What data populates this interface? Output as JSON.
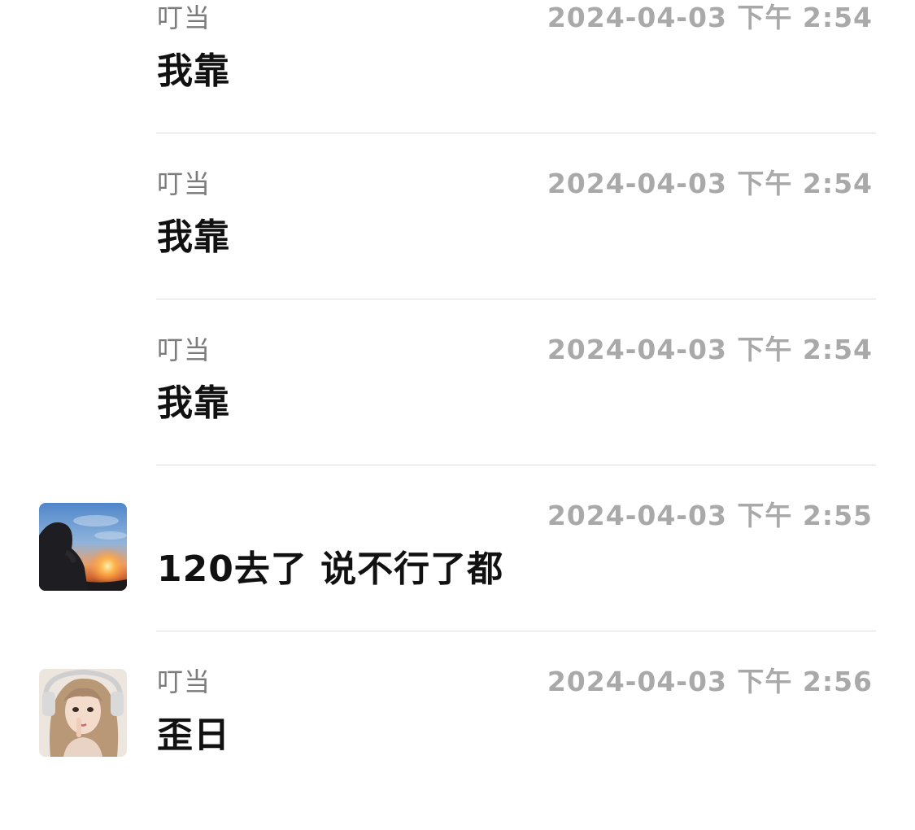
{
  "messages": [
    {
      "sender": "叮当",
      "time": "2024-04-03 下午 2:54",
      "text": "我靠",
      "avatar": ""
    },
    {
      "sender": "叮当",
      "time": "2024-04-03 下午 2:54",
      "text": "我靠",
      "avatar": ""
    },
    {
      "sender": "叮当",
      "time": "2024-04-03 下午 2:54",
      "text": "我靠",
      "avatar": ""
    },
    {
      "sender": "",
      "time": "2024-04-03 下午 2:55",
      "text": "120去了  说不行了都",
      "avatar": "sunset-silhouette-avatar"
    },
    {
      "sender": "叮当",
      "time": "2024-04-03 下午 2:56",
      "text": "歪日",
      "avatar": "girl-headphones-avatar"
    }
  ],
  "colors": {
    "background": "#ffffff",
    "sender_text": "#7b7b7b",
    "time_text": "#a9a9a9",
    "message_text": "#111111",
    "divider": "#dcdcdc"
  }
}
